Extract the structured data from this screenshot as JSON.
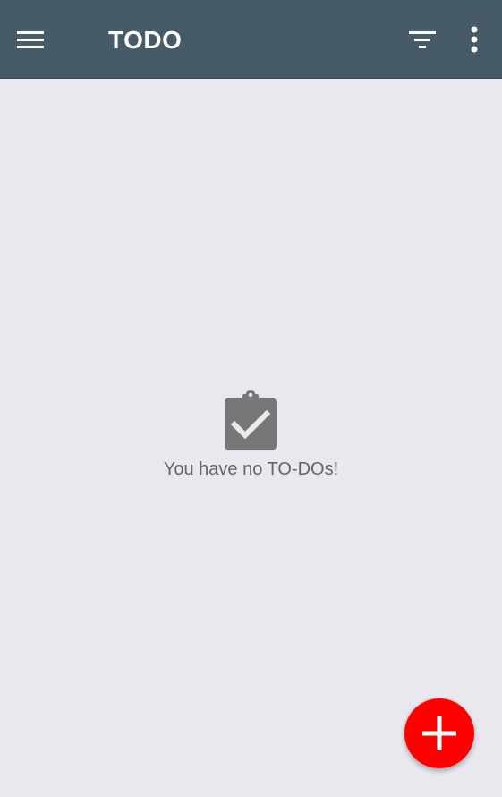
{
  "toolbar": {
    "title": "TODO",
    "menu_icon": "hamburger-menu-icon",
    "filter_icon": "filter-list-icon",
    "overflow_icon": "more-vertical-icon",
    "background_color": "#475a67"
  },
  "empty_state": {
    "icon": "clipboard-check-icon",
    "message": "You have no TO-DOs!"
  },
  "fab": {
    "icon": "plus-icon",
    "color": "#fe0000"
  }
}
